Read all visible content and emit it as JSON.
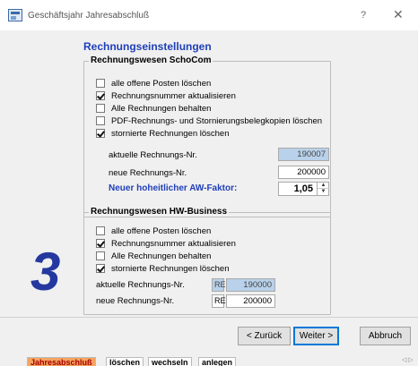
{
  "window": {
    "title": "Geschäftsjahr Jahresabschluß",
    "help_label": "?",
    "close_label": "✕"
  },
  "page": {
    "heading": "Rechnungseinstellungen",
    "step_number": "3"
  },
  "group1": {
    "title": "Rechnungswesen SchoCom",
    "options": [
      {
        "label": "alle offene Posten löschen",
        "checked": false
      },
      {
        "label": "Rechnungsnummer aktualisieren",
        "checked": true
      },
      {
        "label": "Alle Rechnungen behalten",
        "checked": false
      },
      {
        "label": "PDF-Rechnungs- und Stornierungsbelegkopien löschen",
        "checked": false
      },
      {
        "label": "stornierte Rechnungen löschen",
        "checked": true
      }
    ],
    "current_label": "aktuelle Rechnungs-Nr.",
    "current_value": "190007",
    "new_label": "neue Rechnungs-Nr.",
    "new_value": "200000",
    "factor_label": "Neuer hoheitlicher AW-Faktor:",
    "factor_value": "1,05"
  },
  "group2": {
    "title": "Rechnungswesen HW-Business",
    "options": [
      {
        "label": "alle offene Posten löschen",
        "checked": false
      },
      {
        "label": "Rechnungsnummer aktualisieren",
        "checked": true
      },
      {
        "label": "Alle Rechnungen behalten",
        "checked": false
      },
      {
        "label": "stornierte Rechnungen löschen",
        "checked": true
      }
    ],
    "current_label": "aktuelle Rechnungs-Nr.",
    "current_prefix": "RE",
    "current_value": "190000",
    "new_label": "neue Rechnungs-Nr.",
    "new_prefix": "RE",
    "new_value": "200000"
  },
  "buttons": {
    "back": "< Zurück",
    "next": "Weiter >",
    "cancel": "Abbruch"
  },
  "tabs": [
    {
      "label": "Jahresabschluß",
      "active": true
    },
    {
      "label": "löschen",
      "active": false
    },
    {
      "label": "wechseln",
      "active": false
    },
    {
      "label": "anlegen",
      "active": false
    }
  ],
  "nav": {
    "arrows": "◁ ▷"
  }
}
